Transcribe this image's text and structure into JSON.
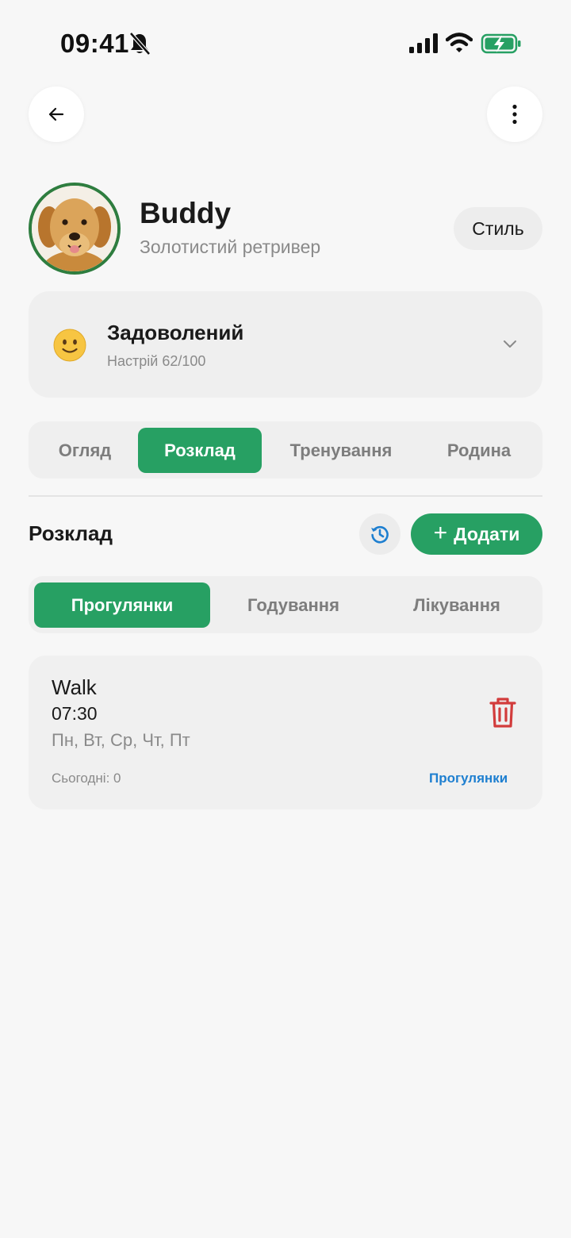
{
  "status_bar": {
    "time": "09:41"
  },
  "profile": {
    "name": "Buddy",
    "breed": "Золотистий ретривер",
    "style_label": "Стиль"
  },
  "mood": {
    "title": "Задоволений",
    "subtitle": "Настрій 62/100",
    "score": 62
  },
  "main_tabs": [
    {
      "label": "Огляд",
      "active": false
    },
    {
      "label": "Розклад",
      "active": true
    },
    {
      "label": "Тренування",
      "active": false
    },
    {
      "label": "Родина",
      "active": false
    }
  ],
  "schedule": {
    "title": "Розклад",
    "add_label": "Додати",
    "sub_tabs": [
      {
        "label": "Прогулянки",
        "active": true
      },
      {
        "label": "Годування",
        "active": false
      },
      {
        "label": "Лікування",
        "active": false
      }
    ],
    "items": [
      {
        "name": "Walk",
        "time": "07:30",
        "days": "Пн, Вт, Ср, Чт, Пт",
        "today": "Сьогодні: 0",
        "category": "Прогулянки"
      }
    ]
  },
  "colors": {
    "accent": "#27a063",
    "avatar_ring": "#2e7d3f",
    "link": "#1e7fd0",
    "danger": "#d23c3c",
    "background": "#f7f7f7"
  },
  "icons": [
    "bell-off-icon",
    "signal-icon",
    "wifi-icon",
    "battery-charging-icon",
    "back-arrow-icon",
    "more-vertical-icon",
    "slightly-smiling-face-icon",
    "chevron-down-icon",
    "history-icon",
    "plus-icon",
    "trash-icon"
  ]
}
